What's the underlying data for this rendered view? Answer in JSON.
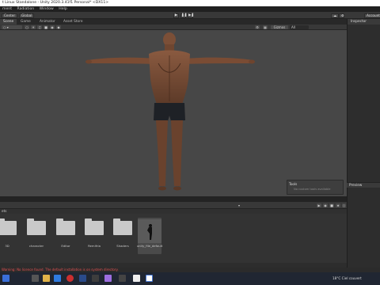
{
  "window": {
    "title": "t Linux Standalone - Unity 2020.3.41f1 Personal* <DX11>"
  },
  "menu": [
    "ment",
    "Radiation",
    "Window",
    "Help"
  ],
  "toolbar": {
    "center_label": "Center",
    "global_label": "Global",
    "play_icons": [
      "play-icon",
      "pause-icon",
      "step-icon"
    ],
    "account_label": "Account"
  },
  "tabs": {
    "scene": "Scene",
    "game": "Game",
    "animator": "Animator",
    "asset_store": "Asset Store",
    "inspector": "Inspector"
  },
  "scene_toolbar": {
    "gizmos_label": "Gizmos",
    "search_placeholder": "All"
  },
  "viewport": {
    "background": "#474747",
    "tools_title": "Tools",
    "tools_sub": "No custom tools available"
  },
  "inspector": {
    "preview_label": "Preview"
  },
  "project": {
    "path": "ets",
    "assets": [
      {
        "name": "3D",
        "type": "folder"
      },
      {
        "name": "character",
        "type": "folder"
      },
      {
        "name": "Editor",
        "type": "folder"
      },
      {
        "name": "Remifria",
        "type": "folder"
      },
      {
        "name": "Shaders",
        "type": "folder"
      },
      {
        "name": "unity_file_default",
        "type": "model"
      }
    ]
  },
  "status": {
    "message": "Warning: No licence found. The default installation is on system directory."
  },
  "taskbar": {
    "weather": "18°C  Ciel couvert",
    "time": "",
    "date": ""
  }
}
